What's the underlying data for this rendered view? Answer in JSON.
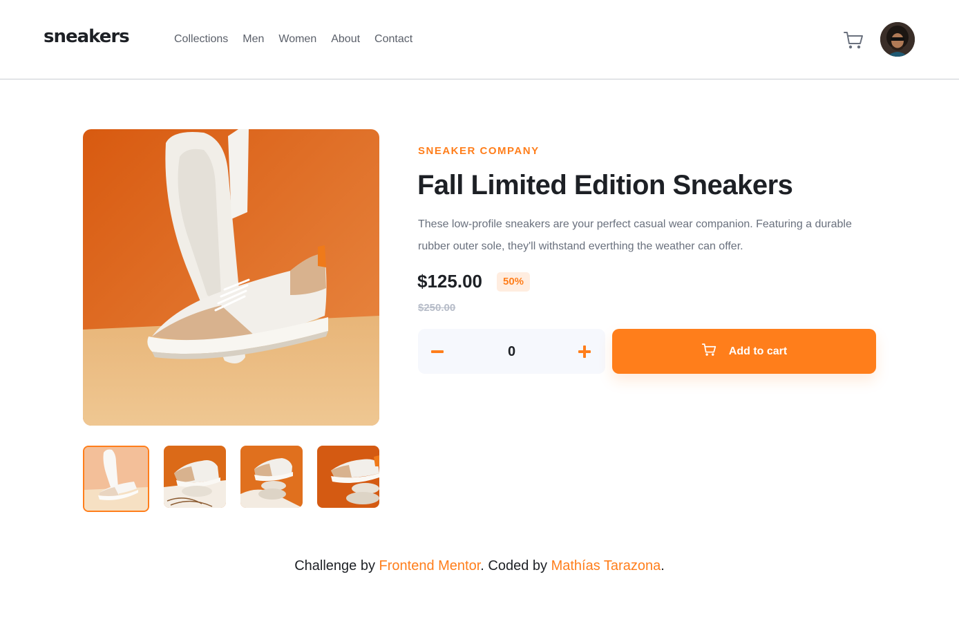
{
  "header": {
    "logo": "sneakers",
    "nav": [
      "Collections",
      "Men",
      "Women",
      "About",
      "Contact"
    ]
  },
  "icons": {
    "cart": "cart-icon",
    "avatar": "user-avatar",
    "minus": "minus-icon",
    "plus": "plus-icon"
  },
  "product": {
    "company": "SNEAKER COMPANY",
    "title": "Fall Limited Edition Sneakers",
    "description": "These low-profile sneakers are your perfect casual wear companion. Featuring a durable rubber outer sole, they'll withstand everthing the weather can offer.",
    "price": "$125.00",
    "discount": "50%",
    "old_price": "$250.00",
    "quantity": "0",
    "add_to_cart": "Add to cart"
  },
  "gallery": {
    "active_index": 0,
    "thumbnail_count": 4
  },
  "footer": {
    "prefix": "Challenge by",
    "link1": "Frontend Mentor",
    "middle": ". Coded by",
    "link2": "Mathías Tarazona",
    "suffix": "."
  },
  "colors": {
    "accent": "#ff7e1b",
    "accent_pale": "#ffede0",
    "dark": "#1d2025",
    "grey": "#69707d"
  }
}
